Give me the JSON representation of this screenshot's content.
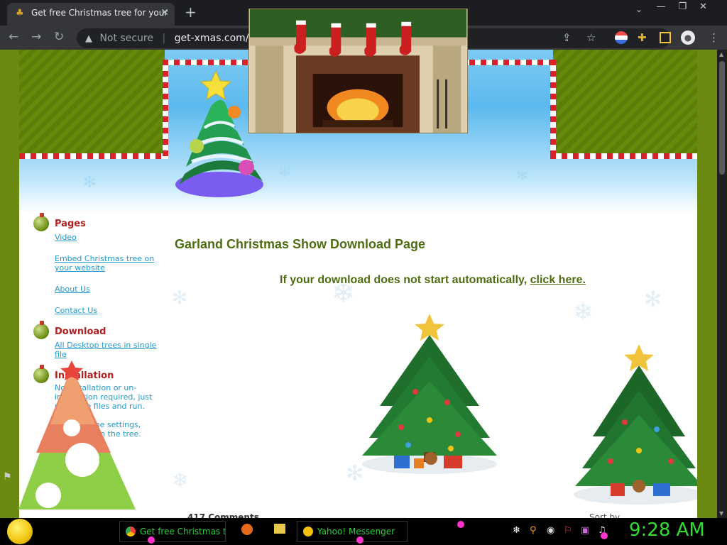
{
  "browser": {
    "tab_title": "Get free Christmas tree for your",
    "new_tab_symbol": "+",
    "not_secure_label": "Not secure",
    "address_host": "get-xmas.com/garla",
    "address_hidden_suffix": "p"
  },
  "page": {
    "sidebar": {
      "sections": [
        {
          "heading": "Pages",
          "links": [
            "Video",
            "Embed Christmas tree on your website",
            "About Us",
            "Contact Us"
          ]
        },
        {
          "heading": "Download",
          "links": [
            "All Desktop trees in single file"
          ]
        },
        {
          "heading": "Installation",
          "texts": [
            "No installation or un-installation required, just unzip the files and run.",
            "To adjust the settings, right click on the tree."
          ]
        }
      ]
    },
    "title": "Garland Christmas Show Download Page",
    "download_prefix": "If your download does not start automatically,",
    "download_link": "click here.",
    "comments_label": "417 Comments",
    "sort_label": "Sort by"
  },
  "taskbar": {
    "buttons": [
      {
        "label": "Get free Christmas t..."
      },
      {
        "label": "Yahoo! Messenger"
      }
    ],
    "clock": "9:28 AM"
  },
  "colors": {
    "accent_green": "#4e6d12",
    "link_blue": "#2299cc",
    "heading_red": "#b32020",
    "clock_green": "#33dd33"
  }
}
